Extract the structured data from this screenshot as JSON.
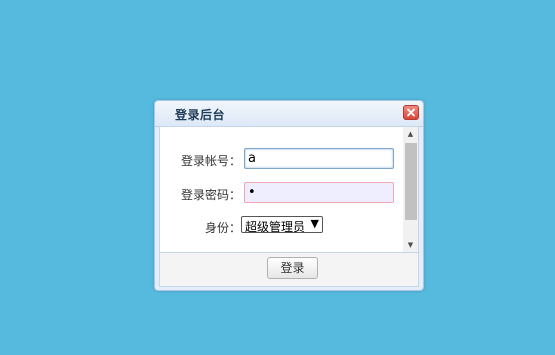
{
  "dialog": {
    "title": "登录后台",
    "close_icon": "close-icon"
  },
  "form": {
    "account": {
      "label": "登录帐号：",
      "value": "a"
    },
    "password": {
      "label": "登录密码：",
      "value": "•"
    },
    "role": {
      "label": "身份：",
      "selected": "超级管理员",
      "arrow": "▼"
    }
  },
  "scrollbar": {
    "up": "▲",
    "down": "▼"
  },
  "footer": {
    "login_label": "登录"
  },
  "colors": {
    "background": "#56bade",
    "close_button": "#d9463b",
    "invalid_field_border": "#f0a5b5"
  }
}
